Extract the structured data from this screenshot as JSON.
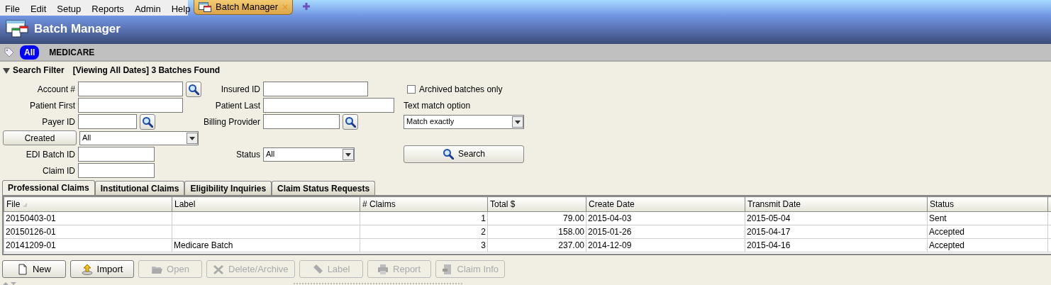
{
  "menu": [
    {
      "label": "File"
    },
    {
      "label": "Edit"
    },
    {
      "label": "Setup"
    },
    {
      "label": "Reports"
    },
    {
      "label": "Admin"
    },
    {
      "label": "Help"
    }
  ],
  "app_tabs": [
    {
      "label": "Batch Manager",
      "selected": true
    }
  ],
  "header": {
    "title": "Batch Manager"
  },
  "tags": [
    {
      "label": "All",
      "selected": true
    },
    {
      "label": "MEDICARE",
      "selected": false
    }
  ],
  "search_filter": {
    "title": "Search Filter",
    "summary": "[Viewing All Dates] 3 Batches Found",
    "expanded": true,
    "columns": [
      [
        {
          "kind": "text",
          "label": "Account #",
          "lookup": true
        },
        {
          "kind": "text",
          "label": "Patient First",
          "lookup": false
        },
        {
          "kind": "text",
          "label": "Payer ID",
          "lookup": true
        },
        {
          "kind": "button_select",
          "label": "Created",
          "value": "All"
        },
        {
          "kind": "text",
          "label": "EDI Batch ID",
          "lookup": false
        },
        {
          "kind": "text",
          "label": "Claim ID",
          "lookup": false
        }
      ],
      [
        {
          "kind": "text",
          "label": "Insured ID",
          "lookup": false
        },
        {
          "kind": "text",
          "label": "Patient Last",
          "lookup": false
        },
        {
          "kind": "text",
          "label": "Billing Provider",
          "lookup": true
        },
        {
          "kind": "empty"
        },
        {
          "kind": "select",
          "label": "Status",
          "value": "All"
        }
      ],
      [
        {
          "kind": "checkbox",
          "label": "Archived batches only",
          "checked": false
        },
        {
          "kind": "caption",
          "label": "Text match option"
        },
        {
          "kind": "select",
          "value": "Match exactly"
        },
        {
          "kind": "empty"
        },
        {
          "kind": "button",
          "label": "Search"
        }
      ]
    ]
  },
  "tabs": [
    {
      "label": "Professional Claims",
      "selected": true
    },
    {
      "label": "Institutional Claims",
      "selected": false
    },
    {
      "label": "Eligibility Inquiries",
      "selected": false
    },
    {
      "label": "Claim Status Requests",
      "selected": false
    }
  ],
  "table": {
    "columns": [
      {
        "label": "File",
        "sorted": true
      },
      {
        "label": "Label",
        "sorted": false
      },
      {
        "label": "# Claims",
        "sorted": false
      },
      {
        "label": "Total $",
        "sorted": false
      },
      {
        "label": "Create Date",
        "sorted": false
      },
      {
        "label": "Transmit Date",
        "sorted": false
      },
      {
        "label": "Status",
        "sorted": false
      }
    ],
    "rows": [
      [
        "20150403-01",
        "",
        "1",
        "79.00",
        "2015-04-03",
        "2015-05-04",
        "Sent"
      ],
      [
        "20150126-01",
        "",
        "2",
        "158.00",
        "2015-01-26",
        "2015-04-17",
        "Accepted"
      ],
      [
        "20141209-01",
        "Medicare Batch",
        "3",
        "237.00",
        "2014-12-09",
        "2015-04-16",
        "Accepted"
      ]
    ]
  },
  "buttons": [
    {
      "label": "New",
      "disabled": false
    },
    {
      "label": "Import",
      "disabled": false
    },
    {
      "label": "Open",
      "disabled": true
    },
    {
      "label": "Delete/Archive",
      "disabled": true
    },
    {
      "label": "Label",
      "disabled": true
    },
    {
      "label": "Report",
      "disabled": true
    },
    {
      "label": "Claim Info",
      "disabled": true
    }
  ]
}
